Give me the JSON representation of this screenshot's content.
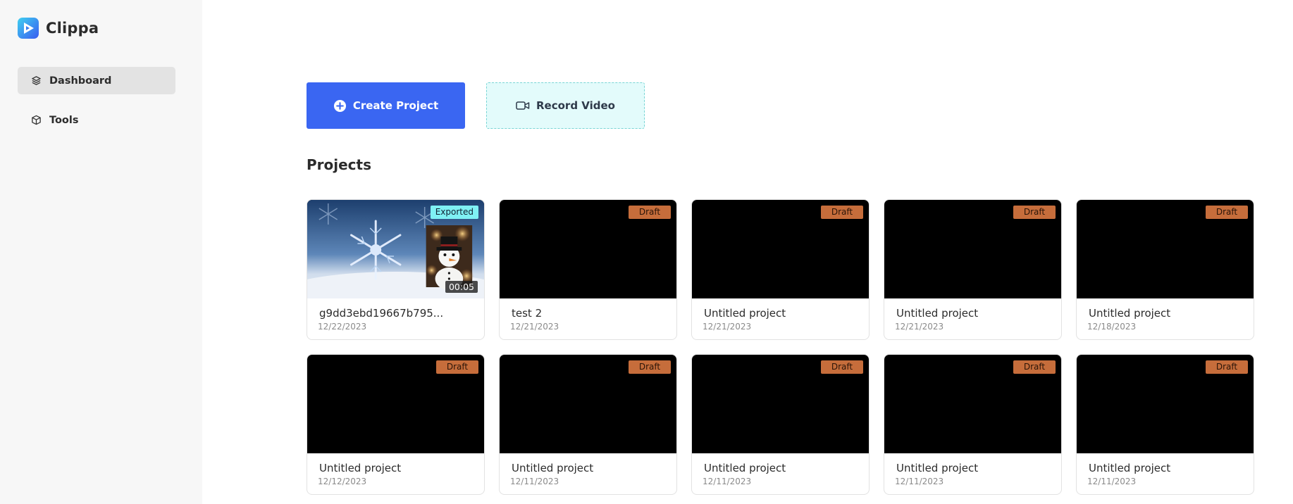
{
  "app": {
    "name": "Clippa"
  },
  "sidebar": {
    "items": [
      {
        "label": "Dashboard",
        "icon": "layers-icon",
        "active": true
      },
      {
        "label": "Tools",
        "icon": "cube-icon",
        "active": false
      }
    ]
  },
  "actions": {
    "create_label": "Create Project",
    "record_label": "Record Video"
  },
  "projects": {
    "title": "Projects",
    "items": [
      {
        "name": "g9dd3ebd19667b795...",
        "date": "12/22/2023",
        "status": "Exported",
        "duration": "00:05"
      },
      {
        "name": "test 2",
        "date": "12/21/2023",
        "status": "Draft"
      },
      {
        "name": "Untitled project",
        "date": "12/21/2023",
        "status": "Draft"
      },
      {
        "name": "Untitled project",
        "date": "12/21/2023",
        "status": "Draft"
      },
      {
        "name": "Untitled project",
        "date": "12/18/2023",
        "status": "Draft"
      },
      {
        "name": "Untitled project",
        "date": "12/12/2023",
        "status": "Draft"
      },
      {
        "name": "Untitled project",
        "date": "12/11/2023",
        "status": "Draft"
      },
      {
        "name": "Untitled project",
        "date": "12/11/2023",
        "status": "Draft"
      },
      {
        "name": "Untitled project",
        "date": "12/11/2023",
        "status": "Draft"
      },
      {
        "name": "Untitled project",
        "date": "12/11/2023",
        "status": "Draft"
      }
    ]
  },
  "colors": {
    "primary": "#3a66f2",
    "record_bg": "#e3fbfb",
    "draft_badge": "#c66d3b",
    "exported_badge": "#7ff1f4",
    "sidebar_bg": "#f7f7f7"
  }
}
